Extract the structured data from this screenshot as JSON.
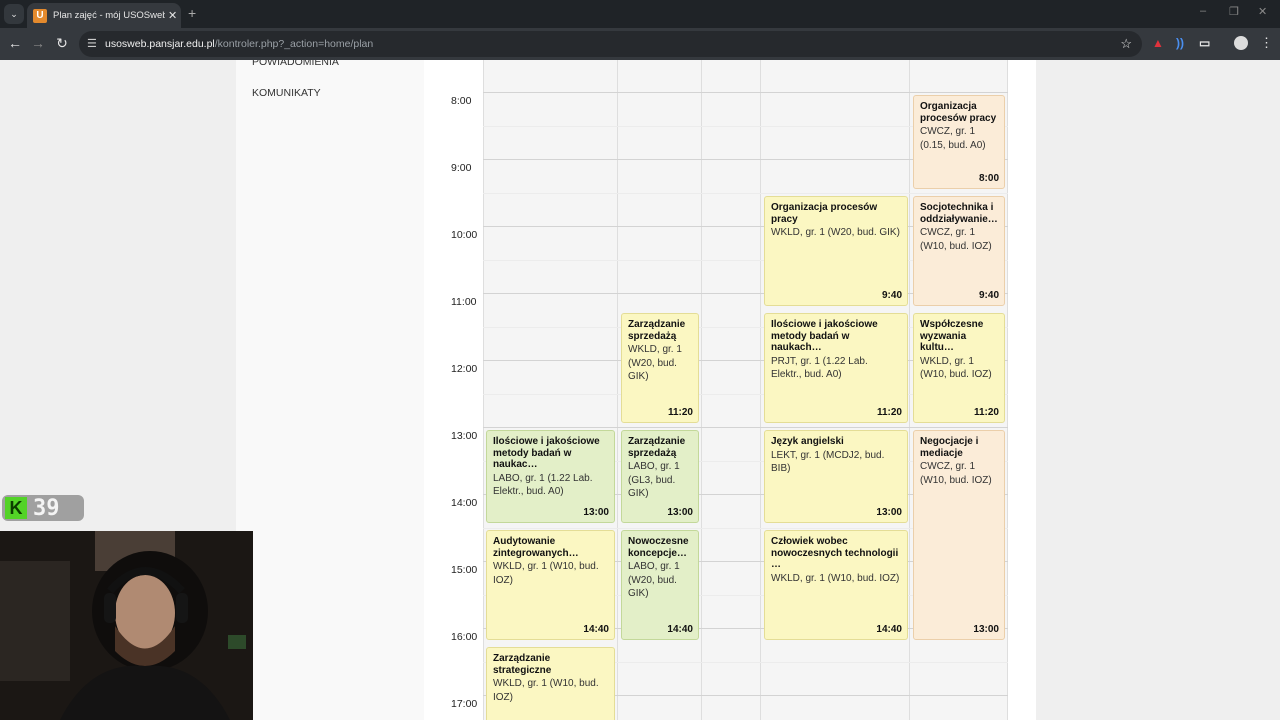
{
  "browser": {
    "tab_title": "Plan zajęć - mój USOSweb - USOS",
    "favicon_letter": "U",
    "url_host": "usosweb.pansjar.edu.pl",
    "url_path": "/kontroler.php?_action=home/plan"
  },
  "sidebar": {
    "items": [
      {
        "label": "POWIADOMIENIA"
      },
      {
        "label": "KOMUNIKATY"
      }
    ]
  },
  "schedule": {
    "times": [
      "8:00",
      "9:00",
      "10:00",
      "11:00",
      "12:00",
      "13:00",
      "14:00",
      "15:00",
      "16:00",
      "17:00"
    ],
    "events": [
      {
        "title": "Organizacja procesów pracy",
        "detail": "CWCZ, gr. 1 (0.15, bud. A0)",
        "start": "8:00",
        "color": "orange"
      },
      {
        "title": "Organizacja procesów pracy",
        "detail": "WKLD, gr. 1 (W20, bud. GIK)",
        "start": "9:40",
        "color": "yellow"
      },
      {
        "title": "Socjotechnika i oddziaływanie…",
        "detail": "CWCZ, gr. 1 (W10, bud. IOZ)",
        "start": "9:40",
        "color": "orange"
      },
      {
        "title": "Zarządzanie sprzedażą",
        "detail": "WKLD, gr. 1 (W20, bud. GIK)",
        "start": "11:20",
        "color": "yellow"
      },
      {
        "title": "Ilościowe i jakościowe metody badań w naukach…",
        "detail": "PRJT, gr. 1 (1.22 Lab. Elektr., bud. A0)",
        "start": "11:20",
        "color": "yellow"
      },
      {
        "title": "Współczesne wyzwania kultu…",
        "detail": "WKLD, gr. 1 (W10, bud. IOZ)",
        "start": "11:20",
        "color": "yellow"
      },
      {
        "title": "Ilościowe i jakościowe metody badań w naukac…",
        "detail": "LABO, gr. 1 (1.22 Lab. Elektr., bud. A0)",
        "start": "13:00",
        "color": "green"
      },
      {
        "title": "Zarządzanie sprzedażą",
        "detail": "LABO, gr. 1 (GL3, bud. GIK)",
        "start": "13:00",
        "color": "green"
      },
      {
        "title": "Język angielski",
        "detail": "LEKT, gr. 1 (MCDJ2, bud. BIB)",
        "start": "13:00",
        "color": "yellow"
      },
      {
        "title": "Negocjacje i mediacje",
        "detail": "CWCZ, gr. 1 (W10, bud. IOZ)",
        "start": "13:00",
        "color": "orange"
      },
      {
        "title": "Audytowanie zintegrowanych…",
        "detail": "WKLD, gr. 1 (W10, bud. IOZ)",
        "start": "14:40",
        "color": "yellow"
      },
      {
        "title": "Nowoczesne koncepcje…",
        "detail": "LABO, gr. 1 (W20, bud. GIK)",
        "start": "14:40",
        "color": "green"
      },
      {
        "title": "Człowiek wobec nowoczesnych technologii …",
        "detail": "WKLD, gr. 1 (W10, bud. IOZ)",
        "start": "14:40",
        "color": "yellow"
      },
      {
        "title": "Zarządzanie strategiczne",
        "detail": "WKLD, gr. 1 (W10, bud. IOZ)",
        "start": "",
        "color": "yellow"
      }
    ]
  },
  "overlay": {
    "badge_letter": "K",
    "badge_number": "39"
  },
  "colors": {
    "event_yellow": "#fbf7c2",
    "event_green": "#e3efc8",
    "event_orange": "#fbecd8"
  }
}
